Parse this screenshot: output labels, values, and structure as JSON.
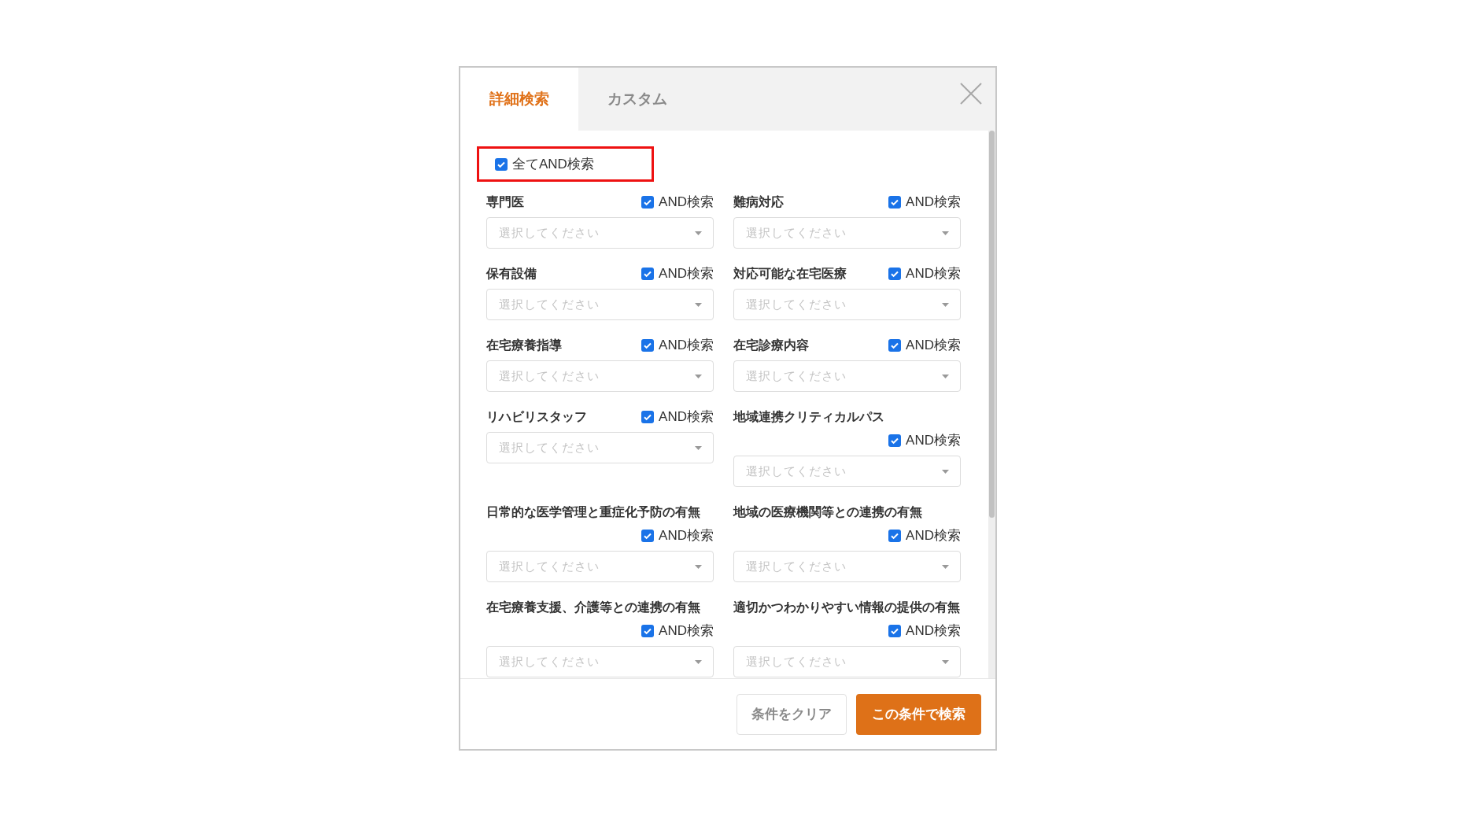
{
  "tabs": [
    {
      "label": "詳細検索",
      "selected": true
    },
    {
      "label": "カスタム",
      "selected": false
    }
  ],
  "all_and": {
    "label": "全てAND検索",
    "checked": true
  },
  "fields": [
    {
      "label": "専門医",
      "and_label": "AND検索",
      "and_checked": true,
      "placeholder": "選択してください"
    },
    {
      "label": "難病対応",
      "and_label": "AND検索",
      "and_checked": true,
      "placeholder": "選択してください"
    },
    {
      "label": "保有設備",
      "and_label": "AND検索",
      "and_checked": true,
      "placeholder": "選択してください"
    },
    {
      "label": "対応可能な在宅医療",
      "and_label": "AND検索",
      "and_checked": true,
      "placeholder": "選択してください"
    },
    {
      "label": "在宅療養指導",
      "and_label": "AND検索",
      "and_checked": true,
      "placeholder": "選択してください"
    },
    {
      "label": "在宅診療内容",
      "and_label": "AND検索",
      "and_checked": true,
      "placeholder": "選択してください"
    },
    {
      "label": "リハビリスタッフ",
      "and_label": "AND検索",
      "and_checked": true,
      "placeholder": "選択してください"
    },
    {
      "label": "地域連携クリティカルパス",
      "and_label": "AND検索",
      "and_checked": true,
      "placeholder": "選択してください"
    },
    {
      "label": "日常的な医学管理と重症化予防の有無",
      "and_label": "AND検索",
      "and_checked": true,
      "placeholder": "選択してください"
    },
    {
      "label": "地域の医療機関等との連携の有無",
      "and_label": "AND検索",
      "and_checked": true,
      "placeholder": "選択してください"
    },
    {
      "label": "在宅療養支援、介護等との連携の有無",
      "and_label": "AND検索",
      "and_checked": true,
      "placeholder": "選択してください"
    },
    {
      "label": "適切かつわかりやすい情報の提供の有無",
      "and_label": "AND検索",
      "and_checked": true,
      "placeholder": "選択してください"
    }
  ],
  "buttons": [
    {
      "label": "条件をクリア",
      "kind": "secondary"
    },
    {
      "label": "この条件で検索",
      "kind": "primary"
    }
  ]
}
